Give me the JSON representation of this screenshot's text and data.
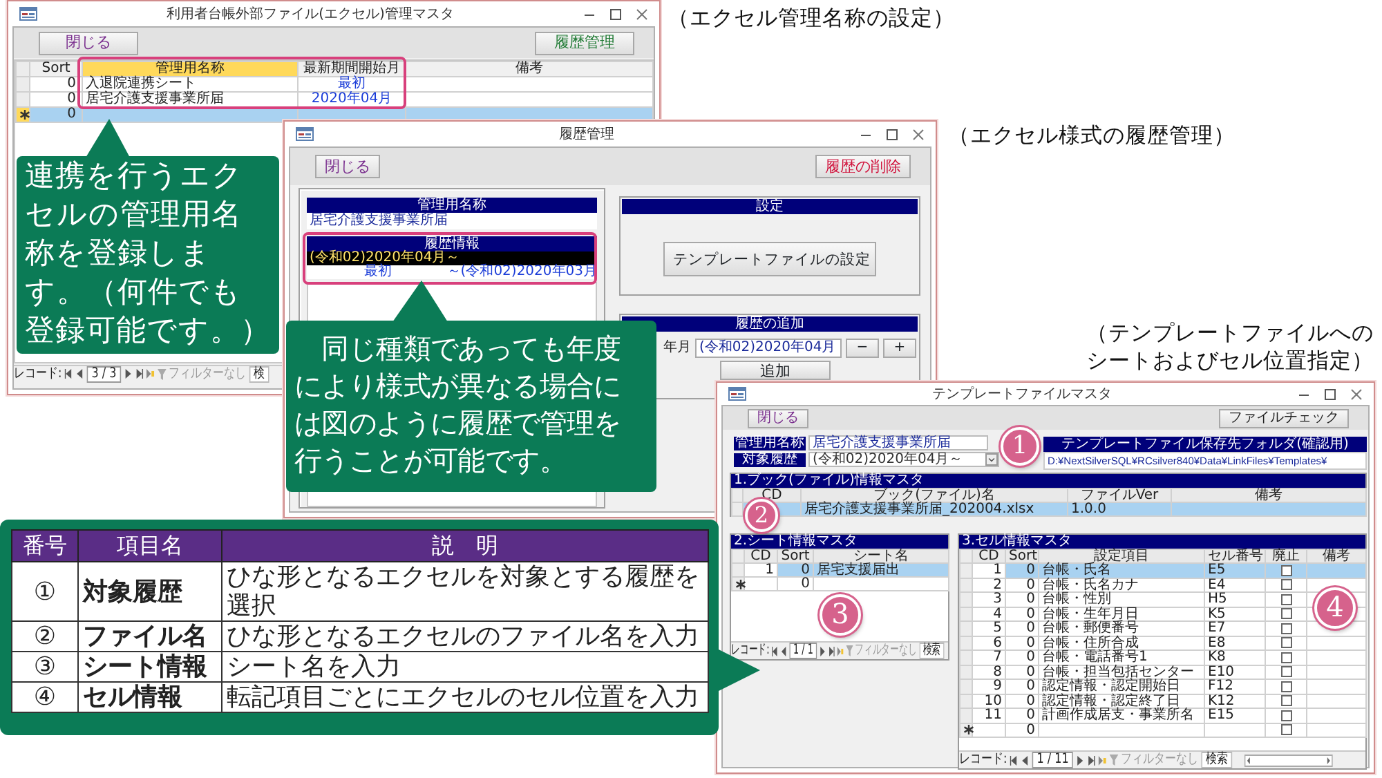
{
  "manage_window": {
    "title": "利用者台帳外部ファイル(エクセル)管理マスタ",
    "buttons": [
      {
        "label": "閉じる",
        "color": "#7a2f8e"
      },
      {
        "label": "履歴管理",
        "color": "#1f7a33"
      }
    ],
    "columns": [
      "Sort",
      "管理用名称",
      "最新期間開始月",
      "備考"
    ],
    "rows": [
      {
        "sort": "0",
        "name": "入退院連携シート",
        "start": "最初",
        "selected": false
      },
      {
        "sort": "0",
        "name": "居宅介護支援事業所届",
        "start": "2020年04月",
        "selected": false
      },
      {
        "sort": "0",
        "selected": true
      }
    ],
    "record_nav": {
      "label": "レコード:",
      "position": "3 / 3",
      "filter": "フィルターなし",
      "search": "検"
    }
  },
  "caption_1": "（エクセル管理名称の設定）",
  "callout_1": "連携を行うエクセルの管理用名称を登録します。（何件でも登録可能です。）",
  "history_window": {
    "title": "履歴管理",
    "buttons": [
      {
        "label": "閉じる",
        "color": "#7a2f8e"
      },
      {
        "label": "履歴の削除",
        "color": "#d0103a"
      }
    ],
    "name_header": "管理用名称",
    "name_value": "居宅介護支援事業所届",
    "history_header": "履歴情報",
    "history_rows": [
      {
        "start": "(令和02)2020年04月～",
        "selected": true
      },
      {
        "start": "最初",
        "end": "～(令和02)2020年03月",
        "selected": false
      }
    ],
    "settings_header": "設定",
    "template_button": "テンプレートファイルの設定",
    "add_header": "履歴の追加",
    "start_label": "年月",
    "start_value": "(令和02)2020年04月",
    "minus": "−",
    "plus": "+",
    "add_button": "追加"
  },
  "caption_2": "（エクセル様式の履歴管理）",
  "callout_2": "　同じ種類であっても年度により様式が異なる場合には図のように履歴で管理を行うことが可能です。",
  "caption_3": [
    "（テンプレートファイルへの",
    "シートおよびセル位置指定）"
  ],
  "template_window": {
    "title": "テンプレートファイルマスタ",
    "buttons": [
      {
        "label": "閉じる",
        "color": "#7a2f8e"
      },
      {
        "label": "ファイルチェック",
        "color": "#222222"
      }
    ],
    "name_label": "管理用名称",
    "name_value": "居宅介護支援事業所届",
    "history_label": "対象履歴",
    "history_value": "(令和02)2020年04月～",
    "folder_header": "テンプレートファイル保存先フォルダ(確認用)",
    "folder_path": "D:¥NextSilverSQL¥RCsilver840¥Data¥LinkFiles¥Templates¥",
    "book": {
      "title": "1.ブック(ファイル)情報マスタ",
      "columns": [
        "CD",
        "ブック(ファイル)名",
        "ファイルVer",
        "備考"
      ],
      "rows": [
        {
          "name": "居宅介護支援事業所届_202004.xlsx",
          "version": "1.0.0",
          "selected": true
        }
      ]
    },
    "sheet": {
      "title": "2.シート情報マスタ",
      "columns": [
        "CD",
        "Sort",
        "シート名"
      ],
      "rows": [
        {
          "cd": "1",
          "sort": "0",
          "name": "居宅支援届出",
          "selected": true
        }
      ],
      "new_row": {
        "sort": "0"
      },
      "record_nav": {
        "label": "レコード:",
        "position": "1 / 1",
        "filter": "フィルターなし",
        "search": "検索"
      }
    },
    "cell": {
      "title": "3.セル情報マスタ",
      "columns": [
        "CD",
        "Sort",
        "設定項目",
        "セル番号",
        "廃止",
        "備考"
      ],
      "rows": [
        {
          "cd": "1",
          "sort": "0",
          "item": "台帳・氏名",
          "cell": "E5",
          "abolished": false,
          "selected": true
        },
        {
          "cd": "2",
          "sort": "0",
          "item": "台帳・氏名カナ",
          "cell": "E4",
          "abolished": false,
          "selected": false
        },
        {
          "cd": "3",
          "sort": "0",
          "item": "台帳・性別",
          "cell": "H5",
          "abolished": false,
          "selected": false
        },
        {
          "cd": "4",
          "sort": "0",
          "item": "台帳・生年月日",
          "cell": "K5",
          "abolished": false,
          "selected": false
        },
        {
          "cd": "5",
          "sort": "0",
          "item": "台帳・郵便番号",
          "cell": "E7",
          "abolished": false,
          "selected": false
        },
        {
          "cd": "6",
          "sort": "0",
          "item": "台帳・住所合成",
          "cell": "E8",
          "abolished": false,
          "selected": false
        },
        {
          "cd": "7",
          "sort": "0",
          "item": "台帳・電話番号1",
          "cell": "K8",
          "abolished": false,
          "selected": false
        },
        {
          "cd": "8",
          "sort": "0",
          "item": "台帳・担当包括センター",
          "cell": "E10",
          "abolished": false,
          "selected": false
        },
        {
          "cd": "9",
          "sort": "0",
          "item": "認定情報・認定開始日",
          "cell": "F12",
          "abolished": false,
          "selected": false
        },
        {
          "cd": "10",
          "sort": "0",
          "item": "認定情報・認定終了日",
          "cell": "K12",
          "abolished": false,
          "selected": false
        },
        {
          "cd": "11",
          "sort": "0",
          "item": "計画作成居支・事業所名",
          "cell": "E15",
          "abolished": false,
          "selected": false
        }
      ],
      "new_row": {
        "sort": "0",
        "abolished": false
      },
      "record_nav": {
        "label": "レコード:",
        "position": "1 / 11",
        "filter": "フィルターなし",
        "search": "検索"
      }
    }
  },
  "markers": [
    "1",
    "2",
    "3",
    "4"
  ],
  "legend_table": {
    "columns": [
      "番号",
      "項目名",
      "説　明"
    ],
    "rows": [
      {
        "no": "①",
        "item": "対象履歴",
        "desc": "ひな形となるエクセルを対象とする履歴を選択"
      },
      {
        "no": "②",
        "item": "ファイル名",
        "desc": "ひな形となるエクセルのファイル名を入力"
      },
      {
        "no": "③",
        "item": "シート情報",
        "desc": "シート名を入力"
      },
      {
        "no": "④",
        "item": "セル情報",
        "desc": "転記項目ごとにエクセルのセル位置を入力"
      }
    ]
  }
}
